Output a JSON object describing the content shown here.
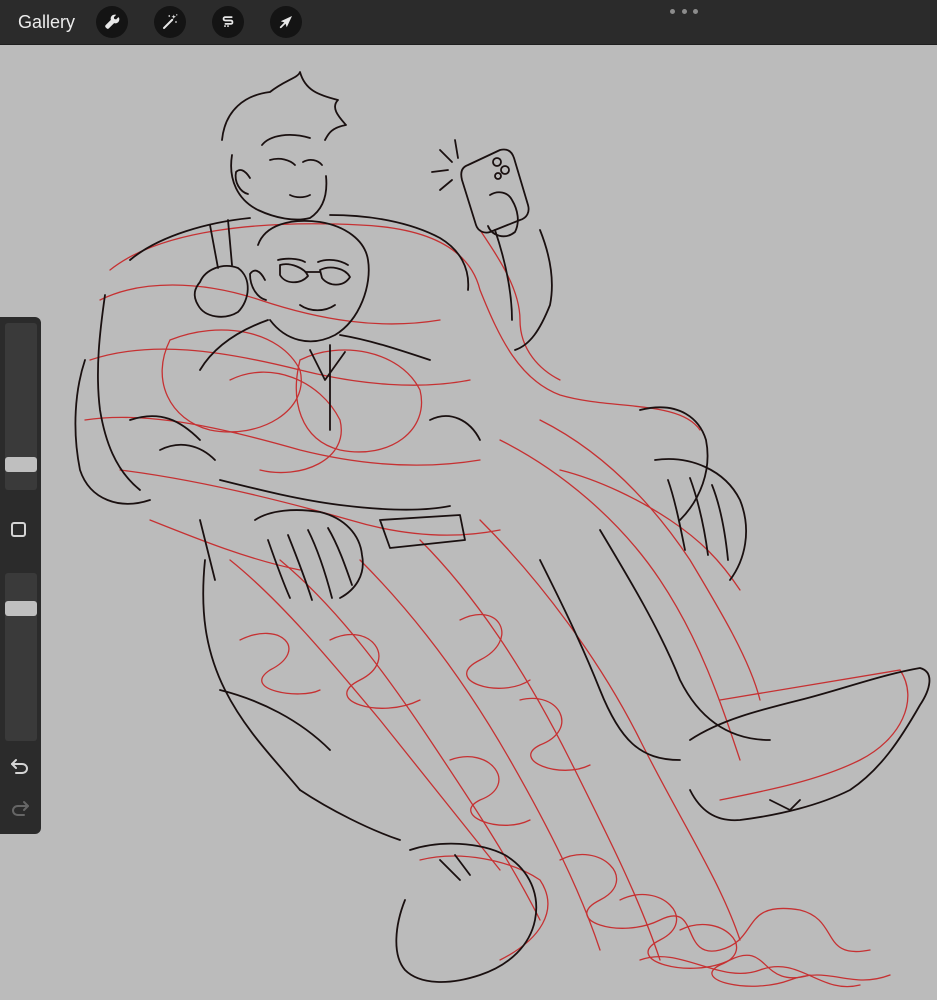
{
  "toolbar": {
    "gallery_label": "Gallery",
    "tools": [
      {
        "icon": "wrench-icon",
        "name": "actions"
      },
      {
        "icon": "magic-wand-icon",
        "name": "adjustments"
      },
      {
        "icon": "selection-s-icon",
        "name": "selection"
      },
      {
        "icon": "arrow-cursor-icon",
        "name": "transform"
      }
    ],
    "more_icon": "ellipsis-icon"
  },
  "sidebar": {
    "brush_size_level": 0.12,
    "opacity_level": 0.82,
    "modify_icon": "square-icon",
    "undo_icon": "undo-arrow-icon",
    "redo_icon": "redo-arrow-icon"
  },
  "canvas": {
    "background": "#bbbbbb",
    "sketch_colors": {
      "lineart": "#1a1010",
      "rough": "#c8191b"
    }
  }
}
